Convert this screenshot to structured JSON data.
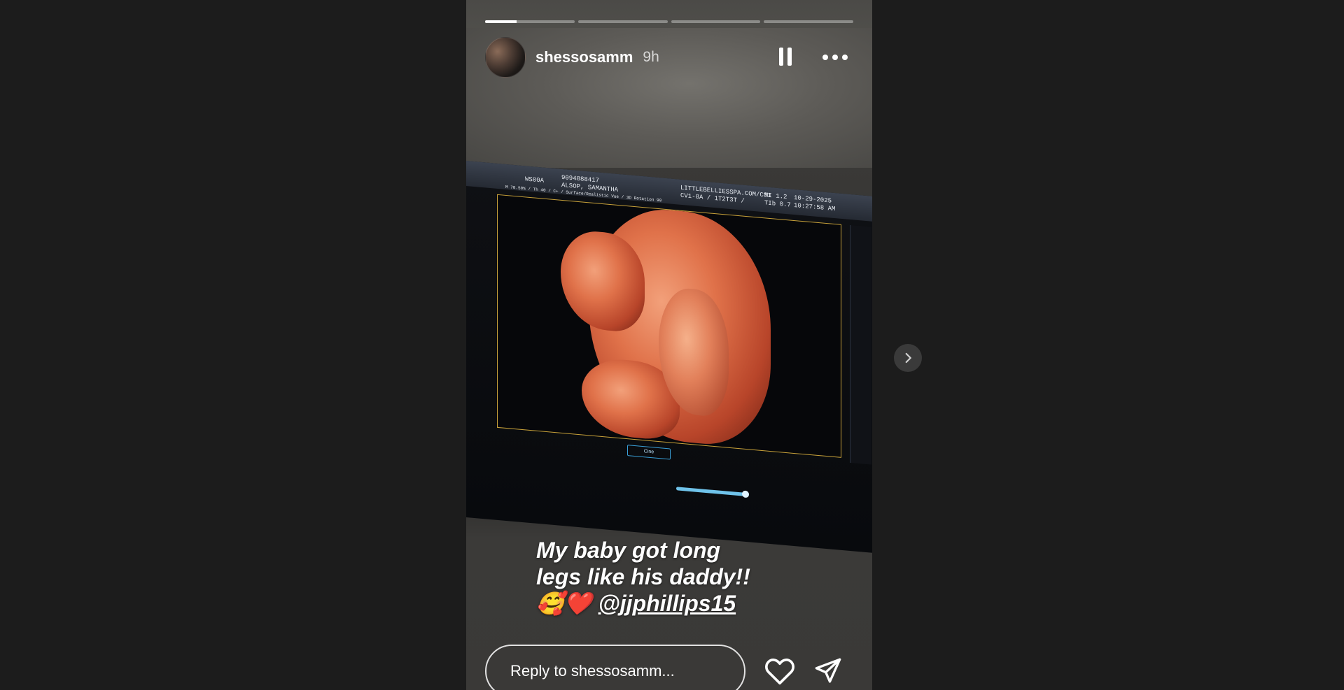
{
  "story": {
    "username": "shessosamm",
    "time_ago": "9h",
    "progress": {
      "segments": 4,
      "active_index": 0,
      "active_fill": 0.35
    }
  },
  "ultrasound": {
    "id_label": "WS80A",
    "patient_id": "9094888417",
    "patient_name": "ALSOP, SAMANTHA",
    "clinic": "LITTLEBELLIESSPA.COM/CS1",
    "probe": "CV1-8A / 1T2T3T /",
    "mi": "MI 1.2",
    "tib": "TIb 0.7",
    "date": "10-29-2025",
    "time": "10:27:58 AM",
    "mode_line": "M 70.50% / Th 40 / C+ / Surface/Realistic Vue / 3D Rotation 90",
    "cine_label": "Cine"
  },
  "caption": {
    "line1": "My baby got long",
    "line2": "legs like his daddy!!",
    "emoji": "🥰❤️",
    "mention": "@jjphillips15"
  },
  "reply": {
    "placeholder": "Reply to shessosamm..."
  },
  "colors": {
    "background": "#1c1c1c",
    "frame": "#c8a23a",
    "cine_blue": "#3aa0d8"
  },
  "icons": [
    "pause-icon",
    "more-icon",
    "heart-icon",
    "send-icon",
    "chevron-right-icon"
  ]
}
